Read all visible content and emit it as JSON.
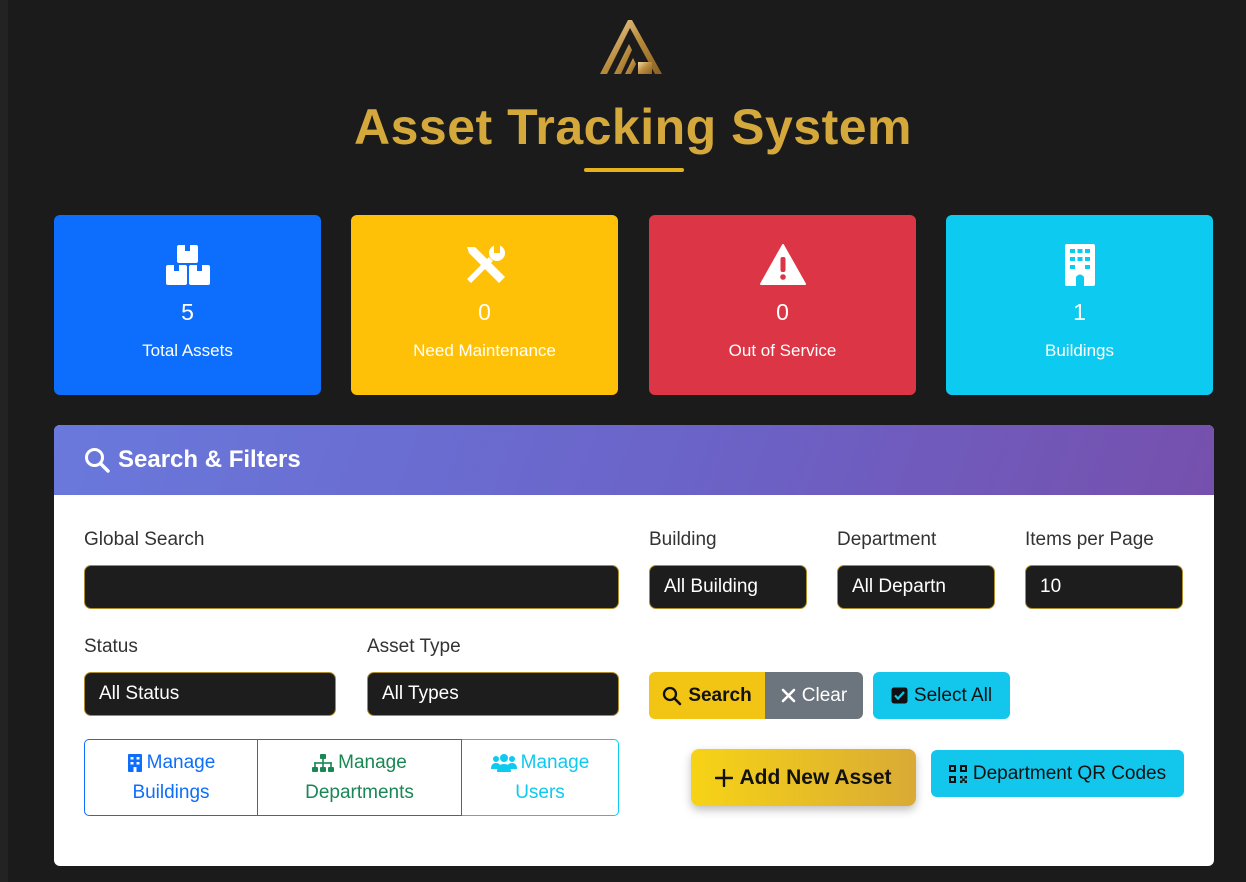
{
  "header": {
    "title": "Asset Tracking System"
  },
  "stats": [
    {
      "value": "5",
      "label": "Total Assets",
      "color": "#0d6efd",
      "icon": "boxes-icon"
    },
    {
      "value": "0",
      "label": "Need Maintenance",
      "color": "#ffc107",
      "icon": "tools-icon"
    },
    {
      "value": "0",
      "label": "Out of Service",
      "color": "#dc3545",
      "icon": "warning-triangle-icon"
    },
    {
      "value": "1",
      "label": "Buildings",
      "color": "#0dcaf0",
      "icon": "building-icon"
    }
  ],
  "filters": {
    "title": "Search & Filters",
    "global_search": {
      "label": "Global Search",
      "value": "",
      "placeholder": ""
    },
    "building": {
      "label": "Building",
      "value": "All Building"
    },
    "department": {
      "label": "Department",
      "value": "All Departn"
    },
    "items_per_page": {
      "label": "Items per Page",
      "value": "10"
    },
    "status": {
      "label": "Status",
      "value": "All Status"
    },
    "asset_type": {
      "label": "Asset Type",
      "value": "All Types"
    },
    "buttons": {
      "search": "Search",
      "clear": "Clear",
      "select_all": "Select All",
      "add_asset": "Add New Asset",
      "qr_codes": "Department QR Codes"
    },
    "manage": {
      "buildings": {
        "line1": "Manage",
        "line2": "Buildings",
        "color": "#0d6efd"
      },
      "departments": {
        "line1": "Manage",
        "line2": "Departments",
        "color": "#198754"
      },
      "users": {
        "line1": "Manage",
        "line2": "Users",
        "color": "#0dcaf0"
      }
    }
  }
}
